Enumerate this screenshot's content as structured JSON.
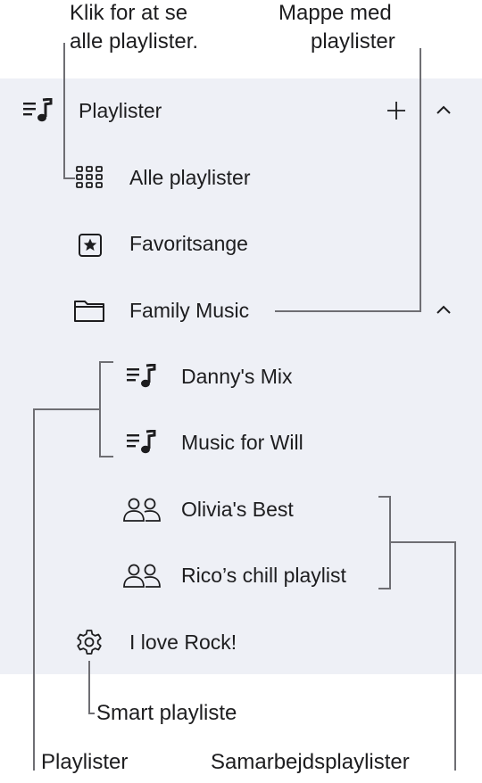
{
  "sidebar": {
    "header_label": "Playlister",
    "add_symbol": "+",
    "items": {
      "all": "Alle playlister",
      "favorites": "Favoritsange",
      "folder": "Family Music",
      "danny": "Danny's Mix",
      "will": "Music for Will",
      "olivia": "Olivia's Best",
      "rico": "Rico’s chill playlist",
      "rock": "I love Rock!"
    }
  },
  "callouts": {
    "all_line1": "Klik for at se",
    "all_line2": "alle playlister.",
    "folder_line1": "Mappe med",
    "folder_line2": "playlister",
    "smart": "Smart playliste",
    "playlists": "Playlister",
    "collab": "Samarbejdsplaylister"
  },
  "colors": {
    "panel": "#eef0f6",
    "line": "#6e6e73",
    "text": "#1d1d1f"
  },
  "icons": [
    "playlist-icon",
    "plus-icon",
    "chevron-up-icon",
    "grid-icon",
    "star-icon",
    "folder-icon",
    "people-icon",
    "gear-icon"
  ]
}
